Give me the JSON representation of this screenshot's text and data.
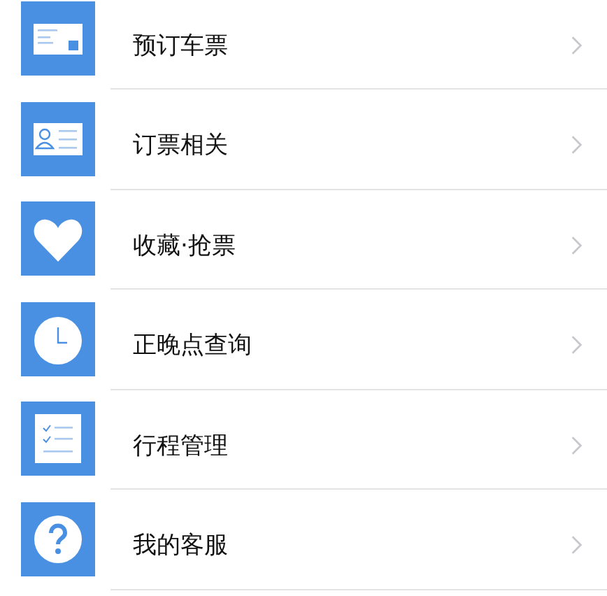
{
  "menu": [
    {
      "kind": "ticket",
      "label": "预订车票"
    },
    {
      "kind": "passenger",
      "label": "订票相关"
    },
    {
      "kind": "favorite",
      "label": "收藏·抢票"
    },
    {
      "kind": "clock",
      "label": "正晚点查询"
    },
    {
      "kind": "checklist",
      "label": "行程管理"
    },
    {
      "kind": "help",
      "label": "我的客服"
    }
  ]
}
